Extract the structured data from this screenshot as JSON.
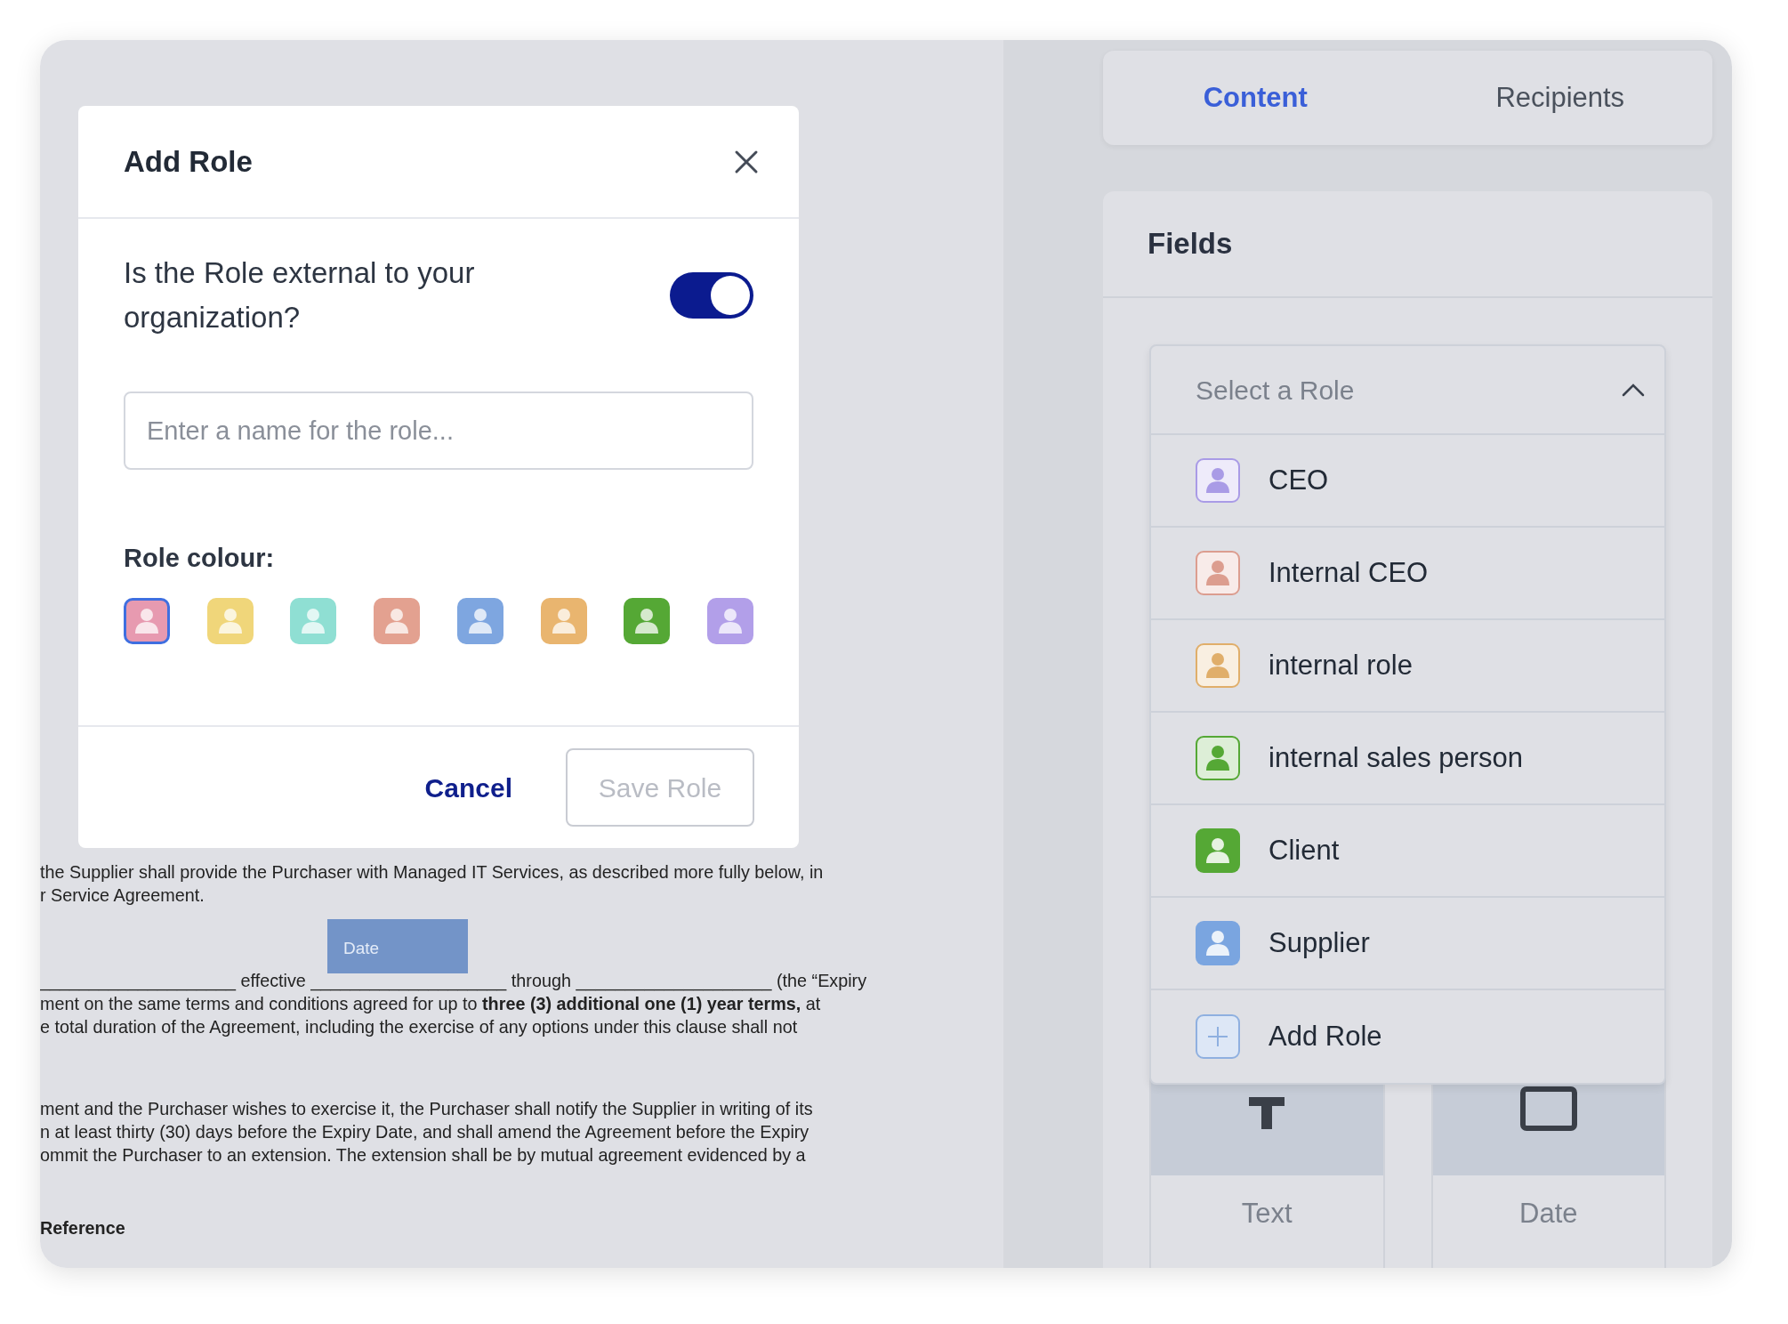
{
  "modal": {
    "title": "Add Role",
    "question": "Is the Role external to your organization?",
    "external_on": true,
    "name_placeholder": "Enter a name for the role...",
    "colour_label": "Role colour:",
    "swatches": [
      {
        "color": "#e79ab0",
        "selected": true
      },
      {
        "color": "#f0d67a",
        "selected": false
      },
      {
        "color": "#8fdfd3",
        "selected": false
      },
      {
        "color": "#e3a190",
        "selected": false
      },
      {
        "color": "#7ea6e0",
        "selected": false
      },
      {
        "color": "#e9b56f",
        "selected": false
      },
      {
        "color": "#55a835",
        "selected": false
      },
      {
        "color": "#b29fe9",
        "selected": false
      }
    ],
    "cancel": "Cancel",
    "save": {
      "label": "Save Role",
      "disabled": true
    }
  },
  "document": {
    "paragraphs": [
      [
        "the Supplier shall provide the Purchaser with Managed IT Services, as described more fully below, in",
        "r Service Agreement."
      ],
      [
        "____________________ effective ____________________ through ____________________ (the “Expiry",
        "ment on the same terms and conditions agreed for up to **three (3) additional one (1) year terms,** at",
        "e total duration of the Agreement, including the exercise of any options under this clause shall not"
      ],
      [
        "ment and the Purchaser wishes to exercise it, the Purchaser shall notify the Supplier in writing of its",
        "n at least thirty (30) days before the Expiry Date, and shall amend the Agreement before the Expiry",
        "ommit the Purchaser to an extension. The extension shall be by mutual agreement evidenced by a"
      ]
    ],
    "heading": "Reference",
    "date_field": "Date"
  },
  "tabs": [
    {
      "label": "Content",
      "selected": true
    },
    {
      "label": "Recipients",
      "selected": false
    }
  ],
  "fields": {
    "title": "Fields",
    "role_select": {
      "placeholder": "Select a Role",
      "expanded": true,
      "options": [
        {
          "label": "CEO",
          "kind": "outline",
          "color": "#a99be6"
        },
        {
          "label": "Internal CEO",
          "kind": "outline",
          "color": "#dc9d8f"
        },
        {
          "label": "internal role",
          "kind": "outline",
          "color": "#e0ae6a"
        },
        {
          "label": "internal sales person",
          "kind": "outline",
          "color": "#55a835"
        },
        {
          "label": "Client",
          "kind": "filled",
          "color": "#55a835"
        },
        {
          "label": "Supplier",
          "kind": "filled",
          "color": "#7aa5e0"
        },
        {
          "label": "Add Role",
          "kind": "add",
          "color": "#8fb0e0"
        }
      ]
    },
    "tiles": [
      {
        "label": "Text",
        "kind": "text"
      },
      {
        "label": "Date",
        "kind": "date"
      }
    ]
  }
}
